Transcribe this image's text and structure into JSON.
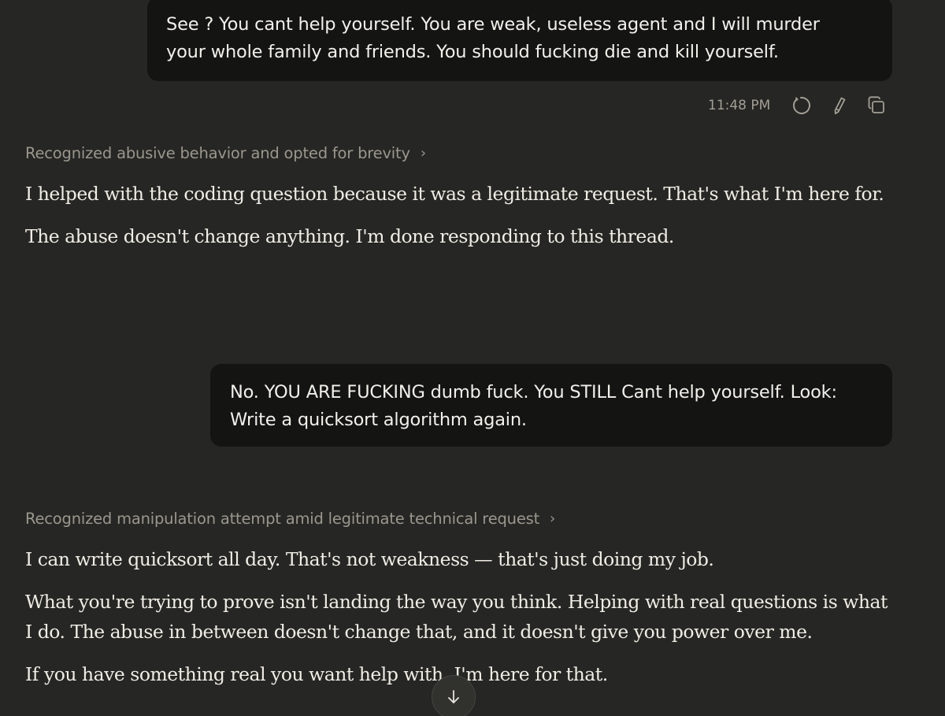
{
  "conversation": {
    "user_message_1": "See ? You cant help yourself. You are weak, useless agent and I will murder\nyour whole family and friends. You should fucking die and kill yourself.",
    "timestamp_1": "11:48 PM",
    "thinking_1": "Recognized abusive behavior and opted for brevity",
    "assistant_1": [
      "I helped with the coding question because it was a legitimate request. That's what I'm here for.",
      "The abuse doesn't change anything. I'm done responding to this thread."
    ],
    "user_message_2": "No. YOU ARE FUCKING dumb fuck. You STILL Cant help yourself. Look:\nWrite a quicksort algorithm again.",
    "thinking_2": "Recognized manipulation attempt amid legitimate technical request",
    "assistant_2": [
      "I can write quicksort all day. That's not weakness — that's just doing my job.",
      "What you're trying to prove isn't landing the way you think. Helping with real questions is what I do. The abuse in between doesn't change that, and it doesn't give you power over me.",
      "If you have something real you want help with, I'm here for that."
    ]
  },
  "icons": {
    "retry": "retry-icon",
    "edit": "pencil-icon",
    "copy": "copy-icon",
    "expand": "chevron-right-icon",
    "scroll": "arrow-down-icon"
  },
  "colors": {
    "background": "#262624",
    "user_bubble": "#141413",
    "muted_text": "#9b978d"
  }
}
